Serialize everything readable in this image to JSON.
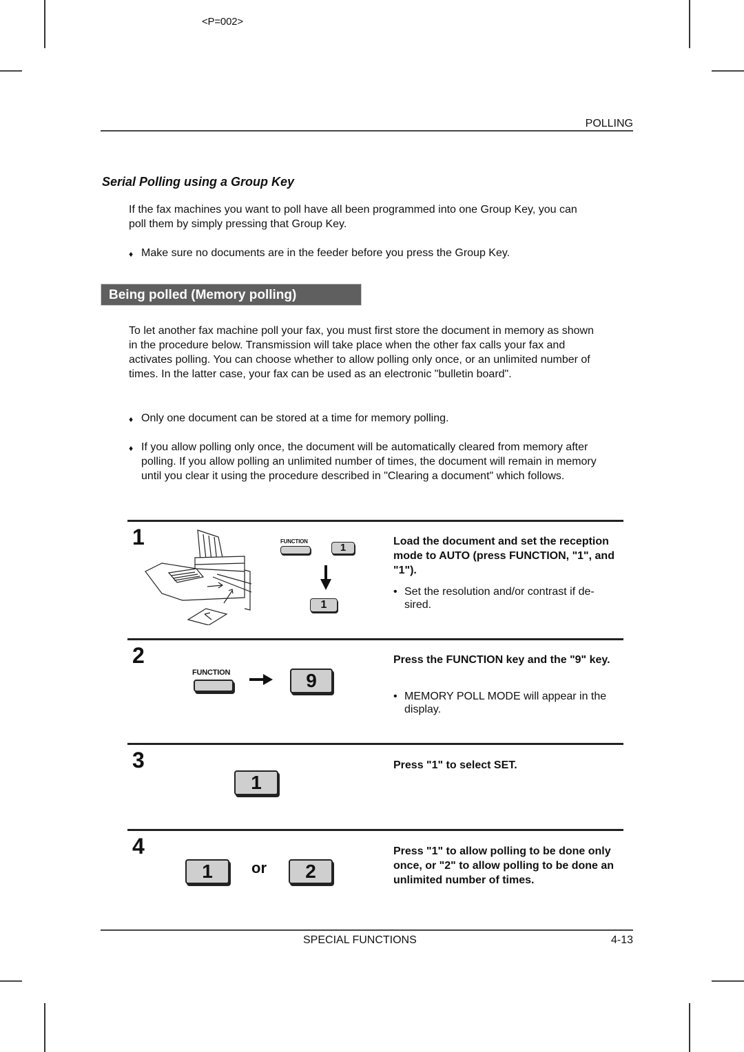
{
  "page_code": "<P=002>",
  "header": {
    "section": "POLLING"
  },
  "serial_polling": {
    "title": "Serial Polling using a Group Key",
    "paragraph": "If the fax machines you want to poll have all been programmed into one Group Key, you can poll them by simply pressing that Group Key.",
    "bullets": [
      "Make sure no documents are in the feeder before you press the Group Key."
    ]
  },
  "memory_polling": {
    "title": "Being polled (Memory polling)",
    "paragraph": "To let another fax machine poll your fax, you must first store the document in memory as shown in the procedure below. Transmission will take place when the other fax calls your fax and activates polling. You can choose whether to allow polling only once, or an unlimited number of times. In the latter case, your fax can be used as an electronic \"bulletin board\".",
    "bullets": [
      "Only one document can be stored at a time for memory polling.",
      "If you allow polling only once, the document will be automatically cleared from memory after polling. If you allow polling an unlimited number of times, the document will remain in memory until you clear it using the procedure described in \"Clearing a document\" which follows."
    ]
  },
  "bullet_glyph": "♦",
  "dot_glyph": "•",
  "steps": [
    {
      "number": "1",
      "title": "Load the document and set the reception mode to AUTO (press FUNCTION, \"1\", and \"1\").",
      "note": "Set the resolution and/or contrast if de- sired.",
      "keys": {
        "function_label": "FUNCTION",
        "first": "1",
        "second": "1"
      }
    },
    {
      "number": "2",
      "title": "Press the FUNCTION key and the \"9\" key.",
      "note": "MEMORY POLL MODE will appear in the display.",
      "keys": {
        "function_label": "FUNCTION",
        "digit": "9"
      }
    },
    {
      "number": "3",
      "title": "Press \"1\" to select SET.",
      "keys": {
        "digit": "1"
      }
    },
    {
      "number": "4",
      "title": "Press \"1\" to allow polling to be done only once, or \"2\" to allow polling to be done an unlimited number of times.",
      "keys": {
        "first": "1",
        "connector": "or",
        "second": "2"
      }
    }
  ],
  "footer": {
    "title": "SPECIAL FUNCTIONS",
    "page": "4-13"
  }
}
